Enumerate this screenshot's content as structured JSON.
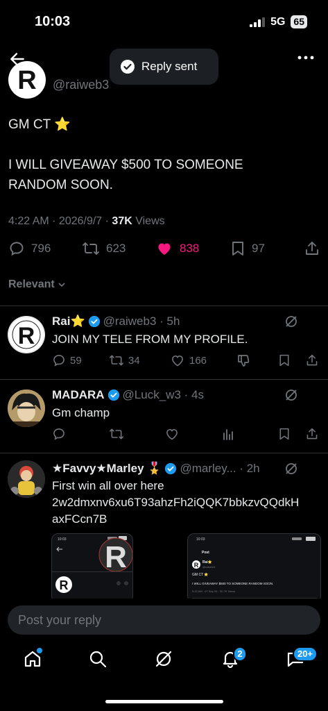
{
  "status_bar": {
    "time": "10:03",
    "network": "5G",
    "battery": "65"
  },
  "toast": {
    "text": "Reply sent"
  },
  "post": {
    "handle": "@raiweb3",
    "line1": "GM CT ⭐",
    "line2": "I WILL GIVEAWAY $500 TO SOMEONE",
    "line3": "RANDOM SOON.",
    "meta_time": "4:22 AM · 2026/9/7 · ",
    "meta_views_count": "37K",
    "meta_views_label": " Views",
    "replies": "796",
    "reposts": "623",
    "likes": "838",
    "bookmarks": "97",
    "liked": true
  },
  "sort_label": "Relevant",
  "replies": [
    {
      "name": "Rai⭐",
      "handle": "@raiweb3 · 5h",
      "text": "JOIN MY TELE FROM MY PROFILE.",
      "reply_count": "59",
      "repost_count": "34",
      "like_count": "166"
    },
    {
      "name": "MADARA",
      "handle": "@Luck_w3 · 4s",
      "text": "Gm champ"
    },
    {
      "name": "★Favvy★Marley 🎖️",
      "handle": "@marley... · 2h",
      "text_line1": "First win all over here",
      "text_line2": "2w2dmxnv6xu6T93ahzFh2iQQK7bbkzvQQdkH",
      "text_line3": "axFCcn7B"
    }
  ],
  "thumbs": {
    "t1_time": "10:03",
    "t2_time": "10:03",
    "t2_header": "Post",
    "t2_name": "Rai⭐",
    "t2_handle": "@raiweb3",
    "t2_line1": "GM CT ⭐",
    "t2_line2": "I WILL GIVEAWAY $500 TO SOMEONE RANDOM SOON.",
    "t2_meta": "9:22 AM · 07 Sep 26 · 30.7K Views"
  },
  "compose": {
    "placeholder": "Post your reply"
  },
  "nav": {
    "notifications_badge": "2",
    "messages_badge": "20+"
  },
  "colors": {
    "background": "#000000",
    "accent": "#1d9bf0",
    "like": "#f91880",
    "muted": "#71767b"
  }
}
